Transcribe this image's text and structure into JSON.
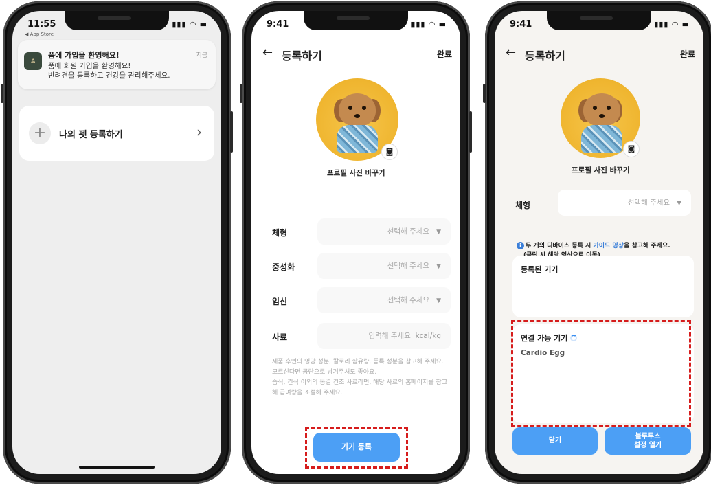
{
  "phone1": {
    "status_time": "11:55",
    "app_store_label": "◀ App Store",
    "notification": {
      "title": "품에 가입을 환영해요!",
      "line1": "품에 회원 가입을 환영해요!",
      "line2": "반려견을 등록하고 건강을 관리해주세요.",
      "time": "지금"
    },
    "register_card": {
      "label": "나의 펫 등록하기",
      "chevron": "›"
    }
  },
  "phone2": {
    "status_time": "9:41",
    "header": {
      "back": "←",
      "title": "등록하기",
      "done": "완료"
    },
    "profile_change": "프로필 사진 바꾸기",
    "fields": [
      {
        "label": "체형",
        "value": "선택해 주세요",
        "caret": "▼"
      },
      {
        "label": "중성화",
        "value": "선택해 주세요",
        "caret": "▼"
      },
      {
        "label": "임신",
        "value": "선택해 주세요",
        "caret": "▼"
      },
      {
        "label": "사료",
        "value": "입력해 주세요",
        "unit": "kcal/kg"
      }
    ],
    "guide_lines": [
      "제품 후면의 영양 성분, 칼로리 함유량, 등록 성분을 참고해 주세요.",
      "모르신다면 공란으로 남겨주셔도 좋아요.",
      "습식, 건식 이외의 동결 건조 사료라면, 해당 사료의 홈페이지를 참고해 급여량을 조절해 주세요."
    ],
    "device_register_button": "기기 등록"
  },
  "phone3": {
    "status_time": "9:41",
    "header": {
      "back": "←",
      "title": "등록하기",
      "done": "완료"
    },
    "profile_change": "프로필 사진 바꾸기",
    "field": {
      "label": "체형",
      "value": "선택해 주세요",
      "caret": "▼"
    },
    "info": {
      "prefix": "두 개의 디바이스 등록 시",
      "link": "가이드 영상",
      "suffix": "을 참고해 주세요.",
      "sub": "(클릭 시 해당 영상으로 이동)"
    },
    "registered_devices_title": "등록된 기기",
    "available_devices_title": "연결 가능 기기",
    "available_devices": [
      "Cardio Egg"
    ],
    "close_button": "닫기",
    "bluetooth_button_line1": "블루투스",
    "bluetooth_button_line2": "설정 열기"
  },
  "colors": {
    "primary_button": "#4c9ff5",
    "highlight_border": "#d61c1c",
    "link": "#3b7fd9",
    "avatar_background": "#efb52f"
  }
}
